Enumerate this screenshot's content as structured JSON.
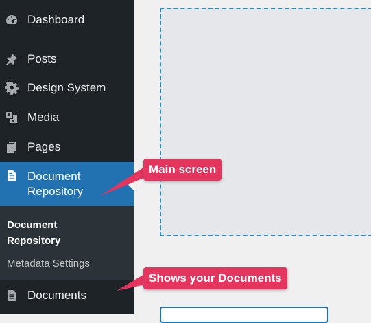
{
  "sidebar": {
    "items": [
      {
        "label": "Dashboard",
        "icon": "dashboard-icon"
      },
      {
        "label": "Posts",
        "icon": "pushpin-icon"
      },
      {
        "label": "Design System",
        "icon": "gear-icon"
      },
      {
        "label": "Media",
        "icon": "media-icon"
      },
      {
        "label": "Pages",
        "icon": "pages-icon"
      },
      {
        "label": "Document Repository",
        "icon": "document-icon",
        "active": true
      },
      {
        "label": "Documents",
        "icon": "document-icon"
      }
    ],
    "submenu": {
      "current": "Document Repository",
      "link": "Metadata Settings"
    }
  },
  "callouts": {
    "main_screen": "Main screen",
    "shows_documents": "Shows your Documents"
  },
  "colors": {
    "sidebar_bg": "#1d2327",
    "submenu_bg": "#2c3338",
    "active_bg": "#2271b1",
    "callout_bg": "#e4355f",
    "placeholder_border": "#2e8bc6"
  }
}
